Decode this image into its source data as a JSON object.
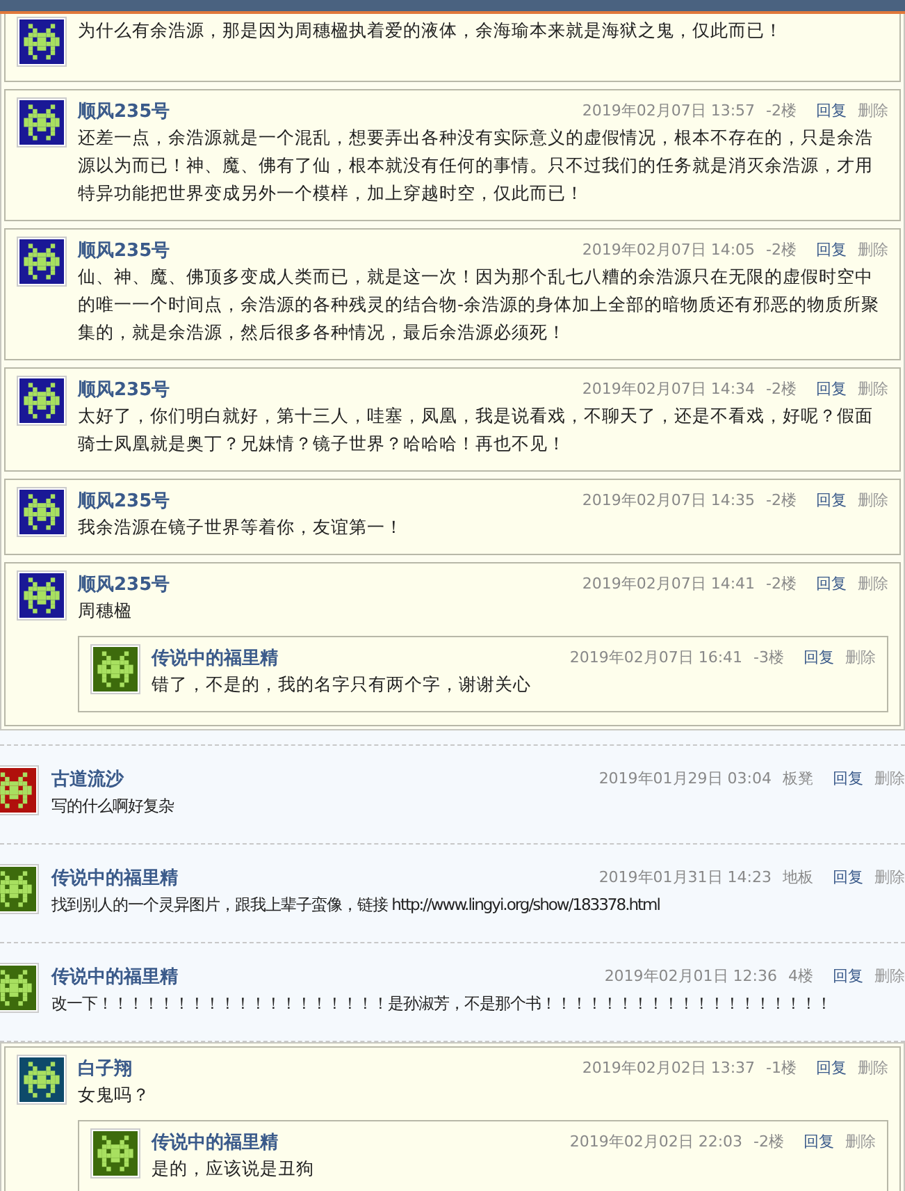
{
  "top_bar": {
    "kind": "overlay"
  },
  "sections": [
    {
      "kind": "reply_group",
      "items": [
        {
          "color": "#1a1896",
          "content": "为什么有余浩源，那是因为周穗楹执着爱的液体，余海瑜本来就是海狱之鬼，仅此而已！"
        },
        {
          "user": "顺风235号",
          "date": "2019年02月07日  13:57",
          "floor": "-2楼",
          "reply": "回复",
          "delete": "删除",
          "color": "#1a1896",
          "content": "还差一点，余浩源就是一个混乱，想要弄出各种没有实际意义的虚假情况，根本不存在的，只是余浩源以为而已！神、魔、佛有了仙，根本就没有任何的事情。只不过我们的任务就是消灭余浩源，才用特异功能把世界变成另外一个模样，加上穿越时空，仅此而已！"
        },
        {
          "user": "顺风235号",
          "date": "2019年02月07日  14:05",
          "floor": "-2楼",
          "reply": "回复",
          "delete": "删除",
          "color": "#1a1896",
          "content": "仙、神、魔、佛顶多变成人类而已，就是这一次！因为那个乱七八糟的余浩源只在无限的虚假时空中的唯一一个时间点，余浩源的各种残灵的结合物-余浩源的身体加上全部的暗物质还有邪恶的物质所聚集的，就是余浩源，然后很多各种情况，最后余浩源必须死！"
        },
        {
          "user": "顺风235号",
          "date": "2019年02月07日  14:34",
          "floor": "-2楼",
          "reply": "回复",
          "delete": "删除",
          "color": "#1a1896",
          "content": "太好了，你们明白就好，第十三人，哇塞，凤凰，我是说看戏，不聊天了，还是不看戏，好呢？假面骑士凤凰就是奥丁？兄妹情？镜子世界？哈哈哈！再也不见！"
        },
        {
          "user": "顺风235号",
          "date": "2019年02月07日  14:35",
          "floor": "-2楼",
          "reply": "回复",
          "delete": "删除",
          "color": "#1a1896",
          "content": "我余浩源在镜子世界等着你，友谊第一！"
        },
        {
          "user": "顺风235号",
          "date": "2019年02月07日  14:41",
          "floor": "-2楼",
          "reply": "回复",
          "delete": "删除",
          "color": "#1a1896",
          "content": "周穗楹",
          "children": [
            {
              "user": "传说中的福里精",
              "date": "2019年02月07日  16:41",
              "floor": "-3楼",
              "reply": "回复",
              "delete": "删除",
              "color": "#3d6b0c",
              "content": "错了，不是的，我的名字只有两个字，谢谢关心"
            }
          ]
        }
      ]
    },
    {
      "kind": "floor",
      "user": "古道流沙",
      "date": "2019年01月29日  03:04",
      "floor": "板凳",
      "reply": "回复",
      "delete": "删除",
      "color": "#b0100c",
      "content": "写的什么啊好复杂"
    },
    {
      "kind": "floor",
      "user": "传说中的福里精",
      "date": "2019年01月31日  14:23",
      "floor": "地板",
      "reply": "回复",
      "delete": "删除",
      "color": "#3d6b0c",
      "content": "找到别人的一个灵异图片，跟我上辈子蛮像，链接 http://www.lingyi.org/show/183378.html"
    },
    {
      "kind": "floor",
      "user": "传说中的福里精",
      "date": "2019年02月01日  12:36",
      "floor": "4楼",
      "reply": "回复",
      "delete": "删除",
      "color": "#3d6b0c",
      "content": "改一下！！！！！！！！！！！！！！！！！！！是孙淑芳，不是那个书！！！！！！！！！！！！！！！！！！！"
    },
    {
      "kind": "reply_group",
      "items": [
        {
          "user": "白子翔",
          "date": "2019年02月02日  13:37",
          "floor": "-1楼",
          "reply": "回复",
          "delete": "删除",
          "color": "#0e4a6a",
          "content": "女鬼吗？",
          "children": [
            {
              "user": "传说中的福里精",
              "date": "2019年02月02日  22:03",
              "floor": "-2楼",
              "reply": "回复",
              "delete": "删除",
              "color": "#3d6b0c",
              "content": "是的，应该说是丑狗"
            }
          ]
        }
      ]
    }
  ]
}
